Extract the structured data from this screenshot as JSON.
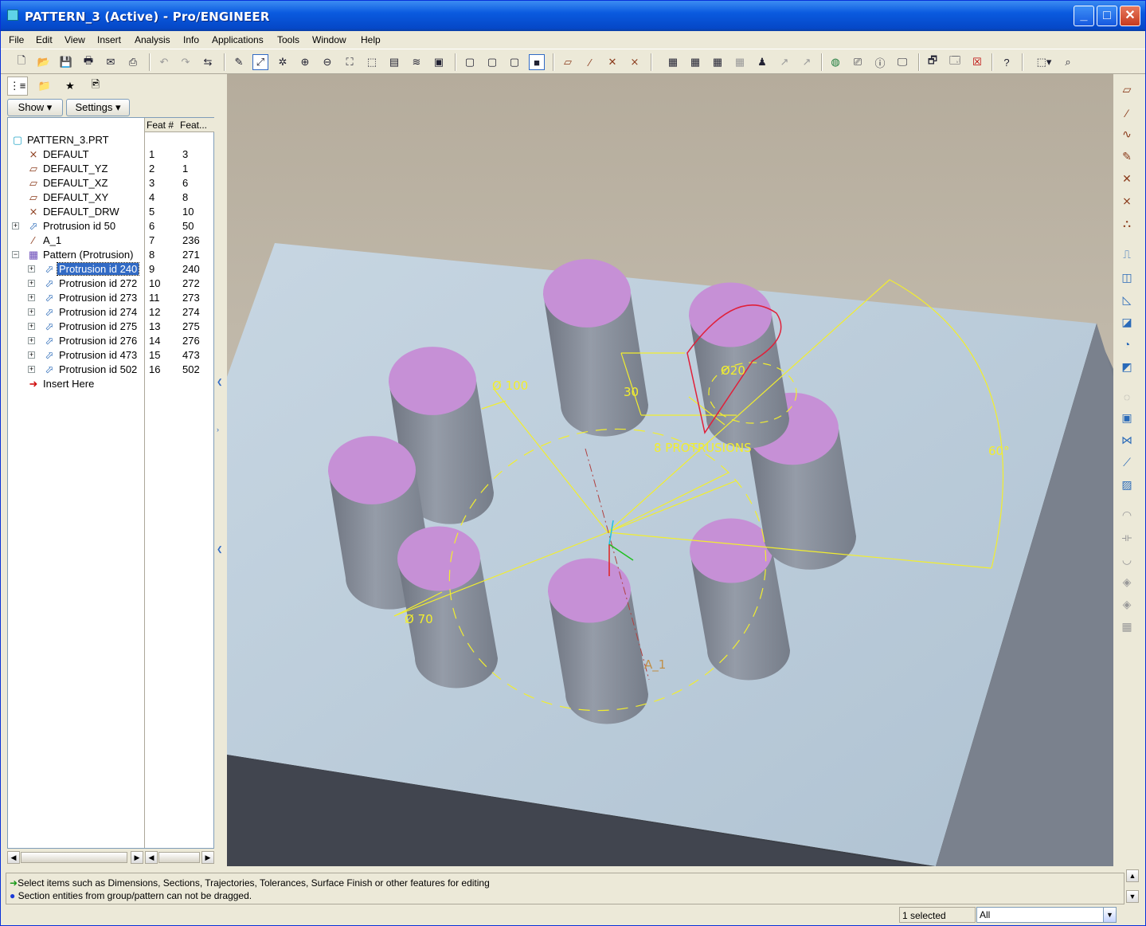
{
  "window": {
    "title": "PATTERN_3 (Active) - Pro/ENGINEER",
    "minimize": "_",
    "maximize": "□",
    "close": "✕"
  },
  "menu": [
    "File",
    "Edit",
    "View",
    "Insert",
    "Analysis",
    "Info",
    "Applications",
    "Tools",
    "Window",
    "Help"
  ],
  "panel": {
    "show_label": "Show ▾",
    "settings_label": "Settings ▾",
    "col_feat_num": "Feat #",
    "col_feat_id": "Feat..."
  },
  "tree": [
    {
      "label": "PATTERN_3.PRT",
      "num": "",
      "id": "",
      "icon": "part-icon"
    },
    {
      "label": "DEFAULT",
      "num": "1",
      "id": "3",
      "icon": "coordinate-system-icon"
    },
    {
      "label": "DEFAULT_YZ",
      "num": "2",
      "id": "1",
      "icon": "datum-plane-icon"
    },
    {
      "label": "DEFAULT_XZ",
      "num": "3",
      "id": "6",
      "icon": "datum-plane-icon"
    },
    {
      "label": "DEFAULT_XY",
      "num": "4",
      "id": "8",
      "icon": "datum-plane-icon"
    },
    {
      "label": "DEFAULT_DRW",
      "num": "5",
      "id": "10",
      "icon": "coordinate-system-icon"
    },
    {
      "label": "Protrusion id 50",
      "num": "6",
      "id": "50",
      "icon": "protrusion-icon"
    },
    {
      "label": "A_1",
      "num": "7",
      "id": "236",
      "icon": "datum-axis-icon"
    },
    {
      "label": "Pattern (Protrusion)",
      "num": "8",
      "id": "271",
      "icon": "pattern-icon"
    },
    {
      "label": "Protrusion id 240",
      "num": "9",
      "id": "240",
      "icon": "protrusion-icon"
    },
    {
      "label": "Protrusion id 272",
      "num": "10",
      "id": "272",
      "icon": "protrusion-icon"
    },
    {
      "label": "Protrusion id 273",
      "num": "11",
      "id": "273",
      "icon": "protrusion-icon"
    },
    {
      "label": "Protrusion id 274",
      "num": "12",
      "id": "274",
      "icon": "protrusion-icon"
    },
    {
      "label": "Protrusion id 275",
      "num": "13",
      "id": "275",
      "icon": "protrusion-icon"
    },
    {
      "label": "Protrusion id 276",
      "num": "14",
      "id": "276",
      "icon": "protrusion-icon"
    },
    {
      "label": "Protrusion id 473",
      "num": "15",
      "id": "473",
      "icon": "protrusion-icon"
    },
    {
      "label": "Protrusion id 502",
      "num": "16",
      "id": "502",
      "icon": "protrusion-icon"
    },
    {
      "label": "Insert Here",
      "num": "",
      "id": "",
      "icon": "insert-arrow-icon"
    }
  ],
  "model": {
    "dim_dia_100": "Ø 100",
    "dim_30": "30",
    "dim_dia_20": "Ø20",
    "dim_pattern_count": "8 PROTRUSIONS",
    "dim_angle": "60°",
    "dim_dia_70": "Ø 70",
    "axis_label": "A_1",
    "colors": {
      "background_top": "#B5AC9C",
      "background_bottom": "#D6D0C4",
      "top_face": "#C4D4E0",
      "side_face": "#7F8793",
      "front_face": "#3E424C",
      "protrusion_top": "#C690D6",
      "protrusion_body": "#858C98",
      "annotation": "#F2EE2E",
      "selected": "#E0203A"
    }
  },
  "messages": {
    "line1": "Select items such as Dimensions, Sections, Trajectories, Tolerances, Surface Finish or other features for editing",
    "line2": "Section entities from group/pattern can not be dragged."
  },
  "status": {
    "selected": "1 selected",
    "filter": "All"
  }
}
